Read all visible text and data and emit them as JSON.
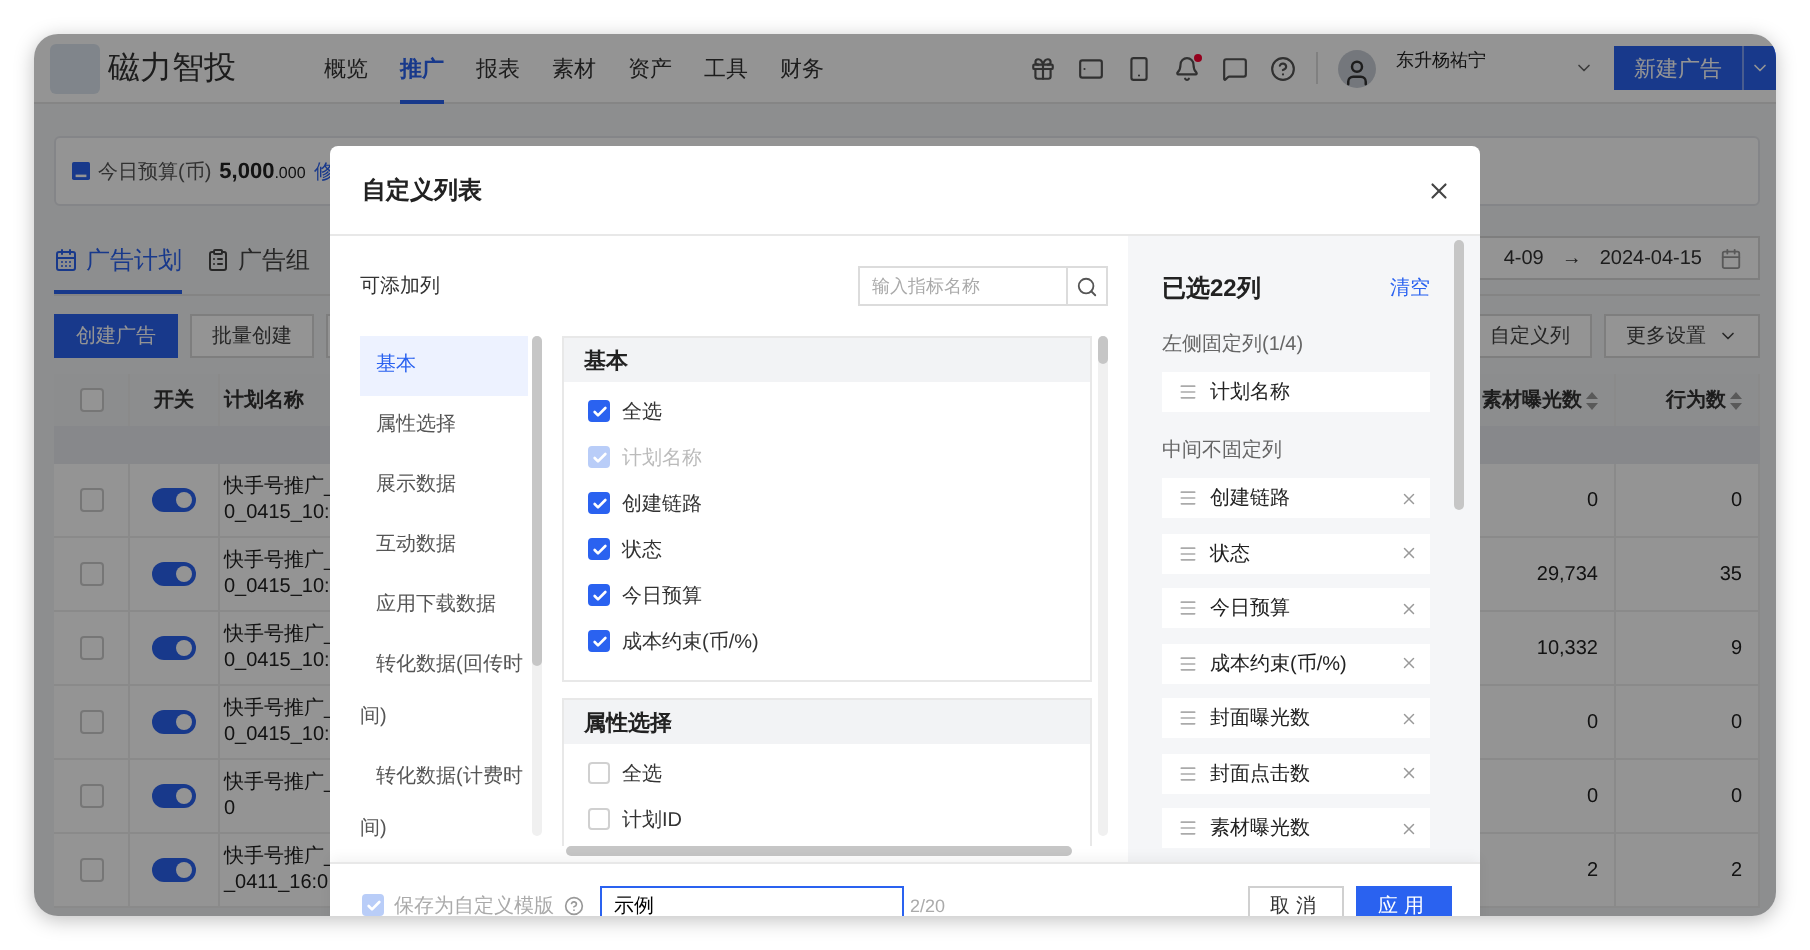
{
  "header": {
    "logo_text": "磁力智投",
    "nav": [
      {
        "label": "概览",
        "selected": false
      },
      {
        "label": "推广",
        "selected": true
      },
      {
        "label": "报表",
        "selected": false
      },
      {
        "label": "素材",
        "selected": false
      },
      {
        "label": "资产",
        "selected": false
      },
      {
        "label": "工具",
        "selected": false
      },
      {
        "label": "财务",
        "selected": false
      }
    ],
    "notification_dot": true,
    "user_name": "东升杨祐宁",
    "primary_button": "新建广告"
  },
  "budget": {
    "label": "今日预算(币)",
    "amount": "5,000",
    "decimals": ".000",
    "link": "修"
  },
  "tabs": [
    {
      "label": "广告计划",
      "selected": true
    },
    {
      "label": "广告组",
      "selected": false
    }
  ],
  "date_range": {
    "start": "4-09",
    "separator": "→",
    "end": "2024-04-15"
  },
  "toolbar": {
    "left": [
      {
        "label": "创建广告",
        "kind": "primary"
      },
      {
        "label": "批量创建",
        "kind": "default"
      }
    ],
    "right": [
      {
        "label": "自定义列",
        "kind": "default"
      },
      {
        "label": "更多设置",
        "kind": "dropdown"
      }
    ]
  },
  "table": {
    "select_all_checked": false,
    "columns": [
      {
        "label": "开关",
        "sortable": false
      },
      {
        "label": "计划名称",
        "sortable": false
      },
      {
        "label": "素材曝光数",
        "sortable": true
      },
      {
        "label": "行为数",
        "sortable": true
      }
    ],
    "rows": [
      {
        "checked": false,
        "on": true,
        "name": [
          "快手号推广_",
          "0_0415_10:"
        ],
        "impressions": "0",
        "actions": "0"
      },
      {
        "checked": false,
        "on": true,
        "name": [
          "快手号推广_",
          "0_0415_10:"
        ],
        "impressions": "29,734",
        "actions": "35"
      },
      {
        "checked": false,
        "on": true,
        "name": [
          "快手号推广_",
          "0_0415_10:"
        ],
        "impressions": "10,332",
        "actions": "9"
      },
      {
        "checked": false,
        "on": true,
        "name": [
          "快手号推广_",
          "0_0415_10:"
        ],
        "impressions": "0",
        "actions": "0"
      },
      {
        "checked": false,
        "on": true,
        "name": [
          "快手号推广_",
          "0"
        ],
        "impressions": "0",
        "actions": "0"
      },
      {
        "checked": false,
        "on": true,
        "name": [
          "快手号推广_",
          "_0411_16:0"
        ],
        "impressions": "2",
        "actions": "2"
      }
    ]
  },
  "dialog": {
    "title": "自定义列表",
    "available_label": "可添加列",
    "search": {
      "placeholder": "输入指标名称"
    },
    "categories": [
      {
        "label": "基本",
        "selected": true
      },
      {
        "label": "属性选择",
        "selected": false
      },
      {
        "label": "展示数据",
        "selected": false
      },
      {
        "label": "互动数据",
        "selected": false
      },
      {
        "label": "应用下载数据",
        "selected": false
      },
      {
        "label": "转化数据(回传时间)",
        "selected": false
      },
      {
        "label": "转化数据(计费时间)",
        "selected": false
      }
    ],
    "groups": [
      {
        "title": "基本",
        "options": [
          {
            "label": "全选",
            "checked": true,
            "disabled": false
          },
          {
            "label": "计划名称",
            "checked": true,
            "disabled": true
          },
          {
            "label": "创建链路",
            "checked": true,
            "disabled": false
          },
          {
            "label": "状态",
            "checked": true,
            "disabled": false
          },
          {
            "label": "今日预算",
            "checked": true,
            "disabled": false
          },
          {
            "label": "成本约束(币/%)",
            "checked": true,
            "disabled": false
          }
        ]
      },
      {
        "title": "属性选择",
        "options": [
          {
            "label": "全选",
            "checked": false,
            "disabled": false
          },
          {
            "label": "计划ID",
            "checked": false,
            "disabled": false
          }
        ]
      }
    ],
    "selected_title": "已选22列",
    "clear": "清空",
    "fixed_label": "左侧固定列(1/4)",
    "fixed": [
      {
        "label": "计划名称",
        "removable": false
      }
    ],
    "middle_label": "中间不固定列",
    "middle": [
      {
        "label": "创建链路",
        "removable": true
      },
      {
        "label": "状态",
        "removable": true
      },
      {
        "label": "今日预算",
        "removable": true
      },
      {
        "label": "成本约束(币/%)",
        "removable": true
      },
      {
        "label": "封面曝光数",
        "removable": true
      },
      {
        "label": "封面点击数",
        "removable": true
      },
      {
        "label": "素材曝光数",
        "removable": true
      }
    ],
    "save_template": {
      "label": "保存为自定义模版",
      "checked": true,
      "disabled": true
    },
    "template_name": {
      "value": "示例",
      "count": "2/20"
    },
    "buttons": [
      {
        "label": "取消",
        "kind": "secondary"
      },
      {
        "label": "应用",
        "kind": "primary"
      }
    ]
  }
}
